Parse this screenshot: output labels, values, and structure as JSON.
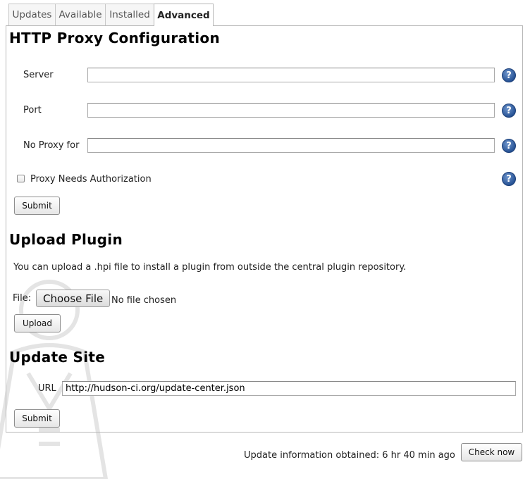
{
  "tabs": [
    {
      "label": "Updates"
    },
    {
      "label": "Available"
    },
    {
      "label": "Installed"
    },
    {
      "label": "Advanced",
      "active": true
    }
  ],
  "proxy": {
    "title": "HTTP Proxy Configuration",
    "server_label": "Server",
    "server_value": "",
    "port_label": "Port",
    "port_value": "",
    "no_proxy_label": "No Proxy for",
    "no_proxy_value": "",
    "auth_label": "Proxy Needs Authorization",
    "auth_checked": false,
    "submit_label": "Submit",
    "help_icon": "question-mark-icon",
    "help_symbol": "?"
  },
  "upload": {
    "title": "Upload Plugin",
    "description": "You can upload a .hpi file to install a plugin from outside the central plugin repository.",
    "file_label": "File:",
    "choose_label": "Choose File",
    "no_file_text": "No file chosen",
    "upload_label": "Upload"
  },
  "update_site": {
    "title": "Update Site",
    "url_label": "URL",
    "url_value": "http://hudson-ci.org/update-center.json",
    "submit_label": "Submit"
  },
  "footer": {
    "update_info": "Update information obtained: 6 hr 40 min ago",
    "check_now_label": "Check now"
  },
  "colors": {
    "help_icon": "#234f92",
    "border": "#b8b8b8"
  }
}
